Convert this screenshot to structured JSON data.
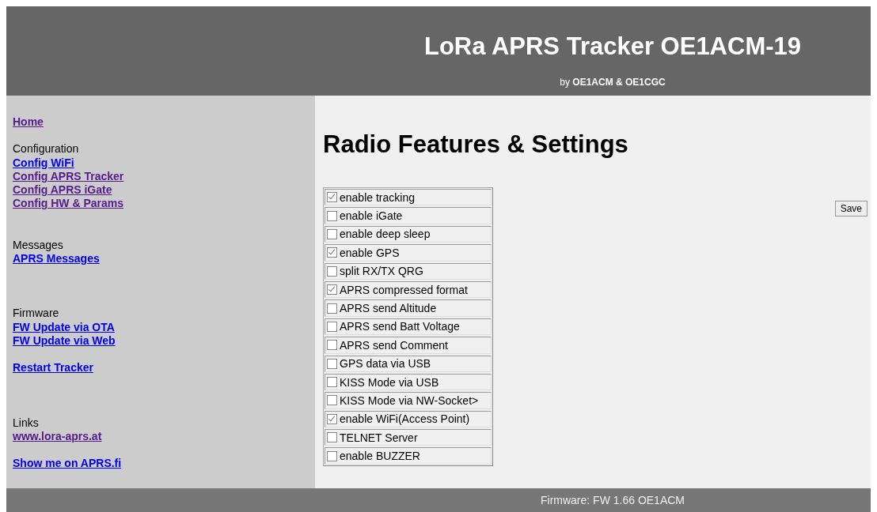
{
  "header": {
    "title": "LoRa APRS Tracker OE1ACM-19",
    "byline_prefix": "by",
    "authors": "OE1ACM & OE1CGC"
  },
  "sidebar": {
    "groups": [
      {
        "links": [
          {
            "label": "Home",
            "visited": true
          }
        ]
      },
      {
        "heading": "Configuration",
        "links": [
          {
            "label": "Config WiFi",
            "visited": false
          },
          {
            "label": "Config APRS Tracker",
            "visited": true
          },
          {
            "label": "Config APRS iGate",
            "visited": true
          },
          {
            "label": "Config HW & Params",
            "visited": true
          }
        ]
      },
      {
        "heading": "Messages",
        "links": [
          {
            "label": "APRS Messages",
            "visited": false
          }
        ]
      },
      {
        "heading": "Firmware",
        "links": [
          {
            "label": "FW Update via OTA",
            "visited": false
          },
          {
            "label": "FW Update via Web",
            "visited": false
          },
          {
            "label": "Restart Tracker",
            "visited": false
          }
        ]
      },
      {
        "heading": "Links",
        "links": [
          {
            "label": "www.lora-aprs.at",
            "visited": true
          },
          {
            "label": "Show me on APRS.fi",
            "visited": false
          }
        ]
      }
    ]
  },
  "main": {
    "title": "Radio Features & Settings",
    "settings": [
      {
        "label": "enable tracking",
        "checked": true
      },
      {
        "label": "enable iGate",
        "checked": false
      },
      {
        "label": "enable deep sleep",
        "checked": false
      },
      {
        "label": "enable GPS",
        "checked": true
      },
      {
        "label": "split RX/TX QRG",
        "checked": false
      },
      {
        "label": "APRS compressed format",
        "checked": true
      },
      {
        "label": "APRS send Altitude",
        "checked": false
      },
      {
        "label": "APRS send Batt Voltage",
        "checked": false
      },
      {
        "label": "APRS send Comment",
        "checked": false
      },
      {
        "label": "GPS data via USB",
        "checked": false
      },
      {
        "label": "KISS Mode via USB",
        "checked": false
      },
      {
        "label": "KISS Mode via NW-Socket>",
        "checked": false
      },
      {
        "label": "enable WiFi(Access Point)",
        "checked": true
      },
      {
        "label": "TELNET Server",
        "checked": false
      },
      {
        "label": "enable BUZZER",
        "checked": false
      }
    ],
    "save_button": "Save"
  },
  "footer": {
    "text": "Firmware: FW 1.66 OE1ACM"
  }
}
